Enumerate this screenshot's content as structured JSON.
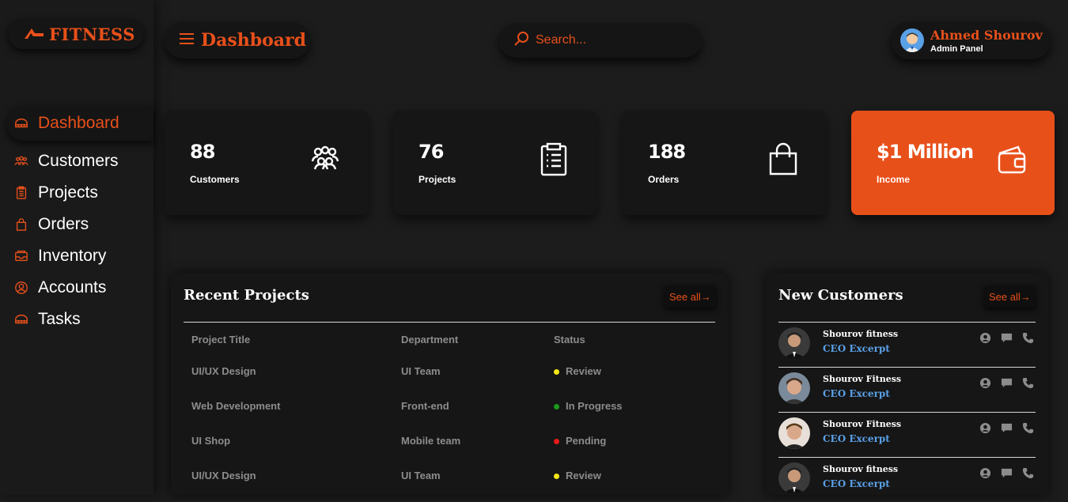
{
  "brand": {
    "name": "FITNESS",
    "icon": "dumbbell-logo-icon"
  },
  "sidebar": {
    "items": [
      {
        "label": "Dashboard",
        "icon": "stadium-icon",
        "active": true
      },
      {
        "label": "Customers",
        "icon": "users-icon"
      },
      {
        "label": "Projects",
        "icon": "clipboard-icon"
      },
      {
        "label": "Orders",
        "icon": "bag-icon"
      },
      {
        "label": "Inventory",
        "icon": "inbox-icon"
      },
      {
        "label": "Accounts",
        "icon": "user-circle-icon"
      },
      {
        "label": "Tasks",
        "icon": "stadium-icon"
      }
    ]
  },
  "header": {
    "title": "Dashboard",
    "search_placeholder": "Search...",
    "user": {
      "name": "Ahmed Shourov",
      "role": "Admin Panel"
    }
  },
  "cards": [
    {
      "value": "88",
      "label": "Customers",
      "icon": "users-icon"
    },
    {
      "value": "76",
      "label": "Projects",
      "icon": "clipboard-icon"
    },
    {
      "value": "188",
      "label": "Orders",
      "icon": "bag-icon"
    },
    {
      "value": "$1 Million",
      "label": "Income",
      "icon": "wallet-icon",
      "highlight": true
    }
  ],
  "recent_projects": {
    "title": "Recent Projects",
    "see_all": "See all",
    "columns": [
      "Project Title",
      "Department",
      "Status"
    ],
    "rows": [
      {
        "title": "UI/UX Design",
        "department": "UI Team",
        "status": "Review",
        "status_color": "#f5e616"
      },
      {
        "title": "Web Development",
        "department": "Front-end",
        "status": "In Progress",
        "status_color": "#1a9a1a"
      },
      {
        "title": "UI Shop",
        "department": "Mobile team",
        "status": "Pending",
        "status_color": "#e81a1a"
      },
      {
        "title": "UI/UX Design",
        "department": "UI Team",
        "status": "Review",
        "status_color": "#f5e616"
      }
    ]
  },
  "new_customers": {
    "title": "New Customers",
    "see_all": "See all",
    "rows": [
      {
        "name": "Shourov fitness",
        "role": "CEO Excerpt"
      },
      {
        "name": "Shourov Fitness",
        "role": "CEO Excerpt"
      },
      {
        "name": "Shourov Fitness",
        "role": "CEO Excerpt"
      },
      {
        "name": "Shourov fitness",
        "role": "CEO Excerpt"
      }
    ]
  },
  "colors": {
    "accent": "#e8501a",
    "background": "#1c1c1c",
    "card": "#161616",
    "link": "#5aa0e6"
  }
}
